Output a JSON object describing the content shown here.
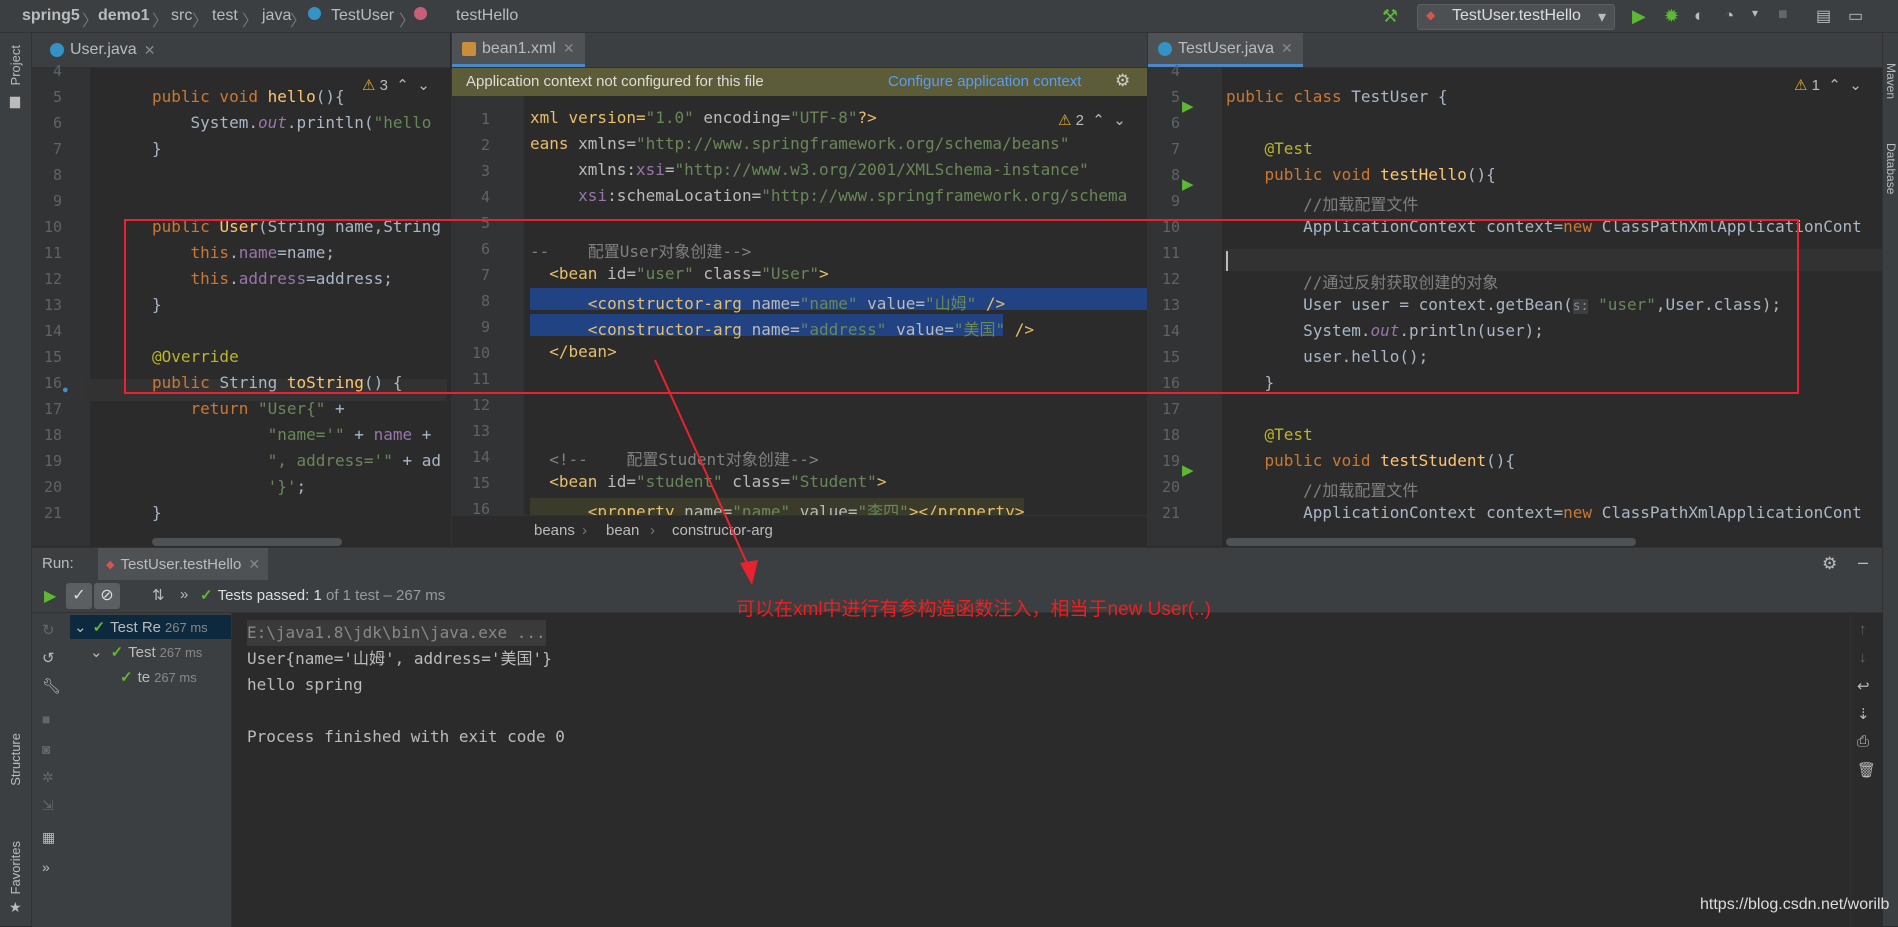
{
  "navbar": {
    "crumbs": [
      "spring5",
      "demo1",
      "src",
      "test",
      "java",
      "TestUser",
      "testHello"
    ],
    "run_config": "TestUser.testHello"
  },
  "left_stripe": {
    "project": "Project",
    "structure": "Structure",
    "favorites": "Favorites"
  },
  "right_stripe": {
    "maven": "Maven",
    "database": "Database"
  },
  "pane_left": {
    "tab": "User.java",
    "warnings": "3",
    "lines": [
      "4",
      "5",
      "6",
      "7",
      "8",
      "9",
      "10",
      "11",
      "12",
      "13",
      "14",
      "15",
      "16",
      "17",
      "18",
      "19",
      "20",
      "21"
    ],
    "code": {
      "l5_a": "public void ",
      "l5_fn": "hello",
      "l5_b": "(){",
      "l6_a": "    System.",
      "l6_out": "out",
      "l6_b": ".println(",
      "l6_str": "\"hello",
      "l7": "}",
      "l10_a": "public ",
      "l10_fn": "User",
      "l10_b": "(String name,String",
      "l11_a": "    ",
      "l11_kw": "this",
      "l11_b": ".",
      "l11_fld": "name",
      "l11_c": "=name;",
      "l12_a": "    ",
      "l12_kw": "this",
      "l12_b": ".",
      "l12_fld": "address",
      "l12_c": "=address;",
      "l13": "}",
      "l15": "@Override",
      "l16_a": "public ",
      "l16_b": "String ",
      "l16_fn": "toString",
      "l16_c": "() {",
      "l17_a": "    return ",
      "l17_str": "\"User{\"",
      "l17_b": " +",
      "l18_a": "            ",
      "l18_str": "\"name='\"",
      "l18_b": " + ",
      "l18_fld": "name",
      "l18_c": " +",
      "l19_a": "            ",
      "l19_str": "\", address='\"",
      "l19_b": " + ad",
      "l20_a": "            ",
      "l20_str": "'}'",
      "l20_b": ";",
      "l21": "}"
    }
  },
  "pane_middle": {
    "tab": "bean1.xml",
    "banner_text": "Application context not configured for this file",
    "banner_link": "Configure application context",
    "warnings": "2",
    "lines": [
      "1",
      "2",
      "3",
      "4",
      "5",
      "6",
      "7",
      "8",
      "9",
      "10",
      "11",
      "12",
      "13",
      "14",
      "15",
      "16"
    ],
    "code": {
      "l1_a": "xml version=",
      "l1_s1": "\"1.0\"",
      "l1_b": " encoding=",
      "l1_s2": "\"UTF-8\"",
      "l1_c": "?>",
      "l2_a": "eans ",
      "l2_b": "xmlns=",
      "l2_s": "\"http://www.springframework.org/schema/beans\"",
      "l3_a": "     xmlns:",
      "l3_b": "xsi",
      "l3_c": "=",
      "l3_s": "\"http://www.w3.org/2001/XMLSchema-instance\"",
      "l4_a": "     ",
      "l4_b": "xsi",
      "l4_c": ":schemaLocation=",
      "l4_s": "\"http://www.springframework.org/schema",
      "l6": "--    配置User对象创建-->",
      "l7_a": "  <bean ",
      "l7_b": "id=",
      "l7_s1": "\"user\"",
      "l7_c": " class=",
      "l7_s2": "\"User\"",
      "l7_d": ">",
      "l8_a": "      <constructor-arg ",
      "l8_b": "name=",
      "l8_s1": "\"name\"",
      "l8_c": " value=",
      "l8_s2": "\"山姆\"",
      "l8_d": " />",
      "l9_a": "      <constructor-arg ",
      "l9_b": "name=",
      "l9_s1": "\"address\"",
      "l9_c": " value=",
      "l9_s2": "\"美国\"",
      "l9_d": " />",
      "l10": "  </bean>",
      "l14": "  <!--    配置Student对象创建-->",
      "l15_a": "  <bean ",
      "l15_b": "id=",
      "l15_s1": "\"student\"",
      "l15_c": " class=",
      "l15_s2": "\"Student\"",
      "l15_d": ">",
      "l16_a": "      <property ",
      "l16_b": "name=",
      "l16_s1": "\"name\"",
      "l16_c": " value=",
      "l16_s2": "\"李四\"",
      "l16_d": "></property>"
    },
    "breadcrumbs": [
      "beans",
      "bean",
      "constructor-arg"
    ]
  },
  "pane_right": {
    "tab": "TestUser.java",
    "warnings": "1",
    "lines": [
      "4",
      "5",
      "6",
      "7",
      "8",
      "9",
      "10",
      "11",
      "12",
      "13",
      "14",
      "15",
      "16",
      "17",
      "18",
      "19",
      "20",
      "21"
    ],
    "code": {
      "l5_a": "public class ",
      "l5_b": "TestUser {",
      "l7": "    @Test",
      "l8_a": "    public void ",
      "l8_fn": "testHello",
      "l8_b": "(){",
      "l9": "        //加载配置文件",
      "l10_a": "        ApplicationContext context=",
      "l10_kw": "new",
      "l10_b": " ClassPathXmlApplicationCont",
      "l12": "        //通过反射获取创建的对象",
      "l13_a": "        User user = context.getBean(",
      "l13_hint": "s:",
      "l13_str": " \"user\"",
      "l13_b": ",User.class);",
      "l14_a": "        System.",
      "l14_out": "out",
      "l14_b": ".println(user);",
      "l15": "        user.hello();",
      "l16": "    }",
      "l18": "    @Test",
      "l19_a": "    public void ",
      "l19_fn": "testStudent",
      "l19_b": "(){",
      "l20": "        //加载配置文件",
      "l21_a": "        ApplicationContext context=",
      "l21_kw": "new",
      "l21_b": " ClassPathXmlApplicationCont"
    }
  },
  "run": {
    "label": "Run:",
    "tab": "TestUser.testHello",
    "status_prefix": "Tests passed: ",
    "status_count": "1",
    "status_suffix": " of 1 test – 267 ms",
    "tree": [
      {
        "label": "Test Re",
        "dur": "267 ms"
      },
      {
        "label": "Test",
        "dur": "267 ms"
      },
      {
        "label": "te",
        "dur": "267 ms"
      }
    ],
    "console": [
      "E:\\java1.8\\jdk\\bin\\java.exe ...",
      "User{name='山姆', address='美国'}",
      "hello spring",
      "",
      "Process finished with exit code 0"
    ]
  },
  "annotation": "可以在xml中进行有参构造函数注入，相当于new User(..)",
  "watermark": "https://blog.csdn.net/worilb",
  "colors": {
    "accent": "#4a88c7",
    "annotation_red": "#e8232f",
    "keyword": "#cc7832",
    "string": "#6a8759",
    "pass_green": "#5fb832"
  }
}
